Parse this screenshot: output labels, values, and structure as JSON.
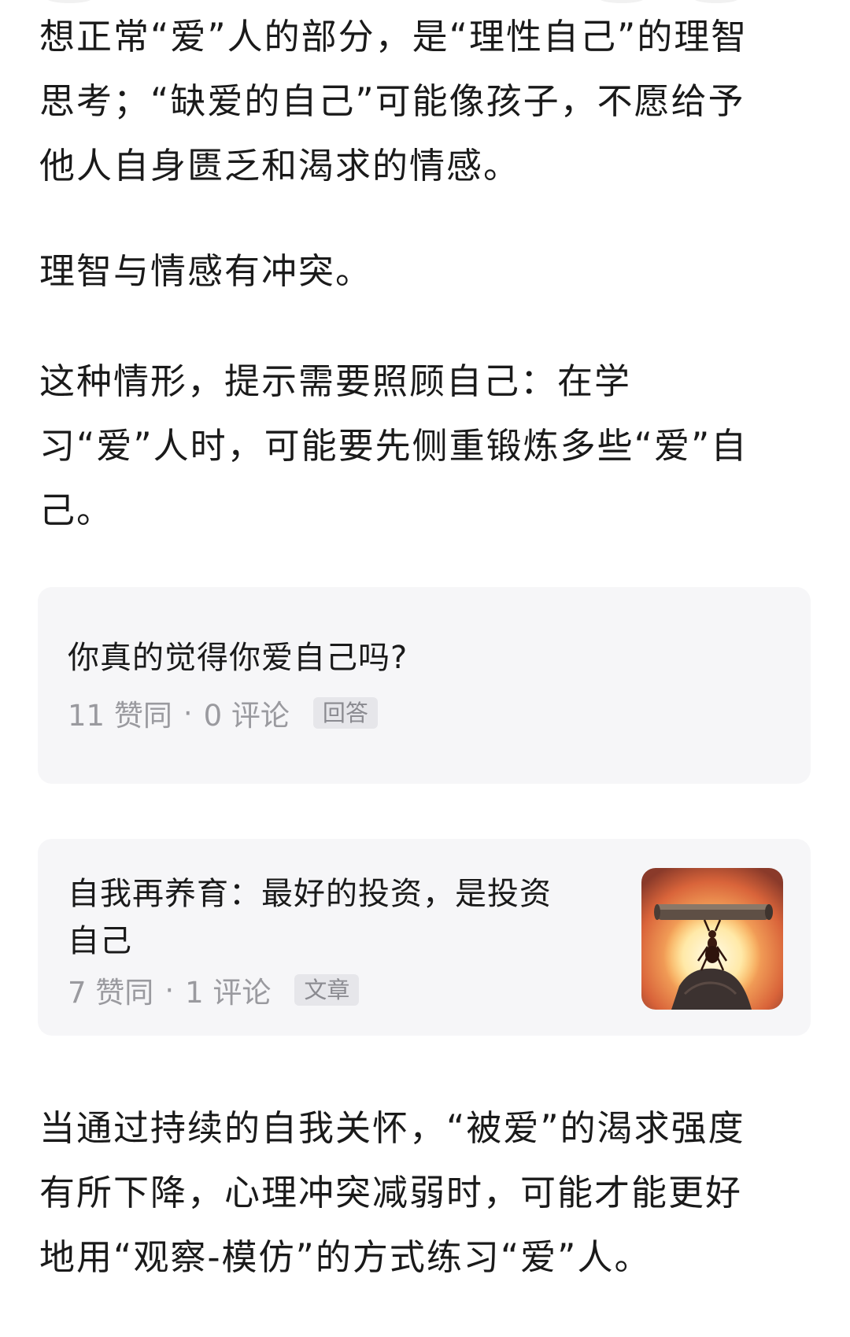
{
  "article": {
    "para1": [
      "想正常“爱”人的部分，是“理性自己”的理智",
      "思考；“缺爱的自己”可能像孩子，不愿给予",
      "他人自身匮乏和渴求的情感。"
    ],
    "para2": "理智与情感有冲突。",
    "para3": [
      "这种情形，提示需要照顾自己：在学",
      "习“爱”人时，可能要先侧重锻炼多些“爱”自",
      "己。"
    ],
    "para4": [
      "当通过持续的自我关怀，“被爱”的渴求强度",
      "有所下降，心理冲突减弱时，可能才能更好",
      "地用“观察-模仿”的方式练习“爱”人。"
    ]
  },
  "cards": [
    {
      "title_lines": [
        "你真的觉得你爱自己吗?"
      ],
      "likes": "11 赞同",
      "sep": "·",
      "comments": "0 评论",
      "tag": "回答"
    },
    {
      "title_lines": [
        "自我再养育：最好的投资，是投资",
        "自己"
      ],
      "likes": "7 赞同",
      "sep": "·",
      "comments": "1 评论",
      "tag": "文章",
      "thumbnail": "ant-lifting-log-sunset-image"
    }
  ],
  "colors": {
    "text": "#1a1a1a",
    "meta": "#9a9a9f",
    "card_bg": "#f6f6f8",
    "tag_bg": "#e6e6ea"
  }
}
